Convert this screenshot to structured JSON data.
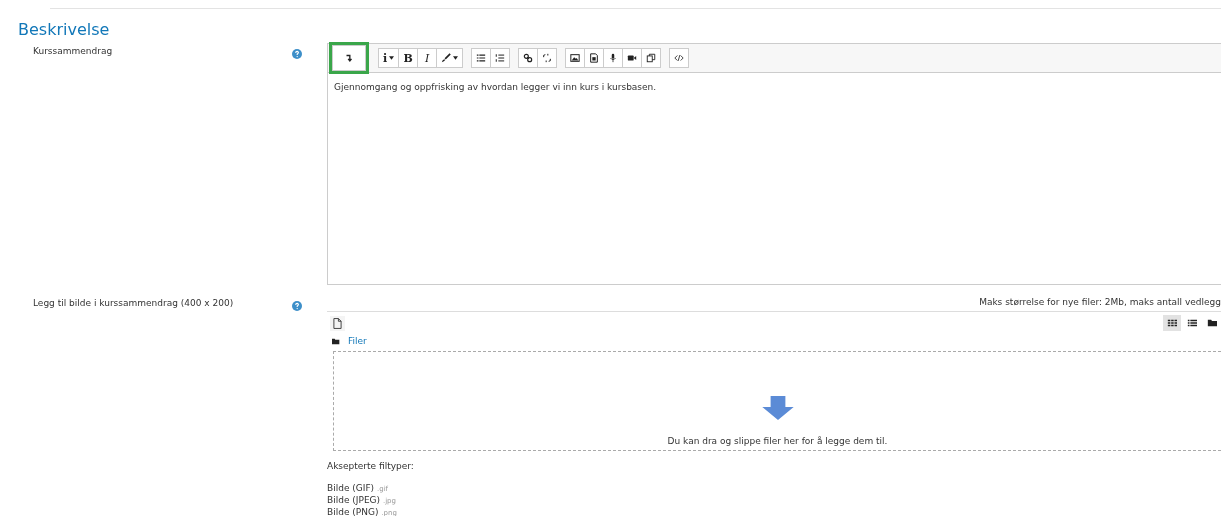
{
  "section": {
    "title": "Beskrivelse"
  },
  "summary": {
    "label": "Kurssammendrag",
    "toolbar": [
      {
        "items": [
          {
            "kind": "icon",
            "highlighted": true
          }
        ]
      },
      {
        "items": [
          {
            "kind": "text",
            "text": "i",
            "highlighted": false
          },
          {
            "kind": "text",
            "text": "B",
            "highlighted": false
          },
          {
            "kind": "text",
            "text": "I",
            "highlighted": false
          },
          {
            "kind": "icon",
            "highlighted": false
          }
        ]
      },
      {
        "items": [
          {
            "kind": "icon",
            "highlighted": false
          },
          {
            "kind": "icon",
            "highlighted": false
          }
        ]
      },
      {
        "items": [
          {
            "kind": "icon",
            "highlighted": false
          },
          {
            "kind": "icon",
            "highlighted": false
          }
        ]
      },
      {
        "items": [
          {
            "kind": "icon",
            "highlighted": false
          },
          {
            "kind": "icon",
            "highlighted": false
          },
          {
            "kind": "icon",
            "highlighted": false
          },
          {
            "kind": "icon",
            "highlighted": false
          },
          {
            "kind": "icon",
            "highlighted": false
          }
        ]
      },
      {
        "items": [
          {
            "kind": "icon",
            "highlighted": false
          }
        ]
      }
    ],
    "value": "Gjennomgang og oppfrisking av hvordan legger vi inn kurs i kursbasen."
  },
  "image_field": {
    "label": "Legg til bilde i kurssammendrag (400 x 200)",
    "limits": "Maks størrelse for nye filer: 2Mb, maks antall vedlegg",
    "views": [
      {
        "selected": true
      },
      {
        "selected": false
      },
      {
        "selected": false
      }
    ],
    "folder": "Filer",
    "drop_hint": "Du kan dra og slippe filer her for å legge dem til.",
    "accepted_label": "Aksepterte filtyper:",
    "types": [
      {
        "name": "Bilde (GIF)",
        "ext": ".gif"
      },
      {
        "name": "Bilde (JPEG)",
        "ext": ".jpg"
      },
      {
        "name": "Bilde (PNG)",
        "ext": ".png"
      }
    ]
  }
}
